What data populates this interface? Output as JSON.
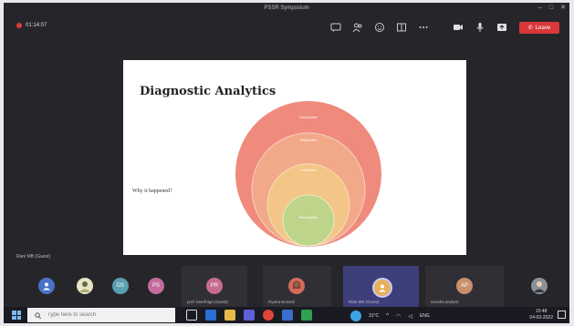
{
  "window": {
    "title": "PSSR Symposium",
    "controls": [
      "–",
      "□",
      "✕"
    ]
  },
  "meeting": {
    "recording_time": "01:14:07",
    "toolbar_icons": [
      "chat-icon",
      "people-icon",
      "reactions-icon",
      "rooms-icon",
      "more-icon"
    ],
    "media_icons": [
      "camera-icon",
      "mic-icon",
      "share-icon"
    ],
    "leave_label": "Leave",
    "colors": {
      "leave": "#d9383b",
      "record": "#e23b3b"
    }
  },
  "slide": {
    "title": "Diagnostic Analytics",
    "question": "Why it happened?",
    "circle_labels": [
      "Descriptive",
      "Diagnostic",
      "Predictive",
      "Prescriptive"
    ],
    "colors": [
      "#ef8a7d",
      "#f2a98a",
      "#f3c586",
      "#bfd48b"
    ]
  },
  "presenter_label": "Rani MB (Guest)",
  "participants": [
    {
      "initials": "",
      "name": "",
      "color": "#4b71c8",
      "icon": "user-icon"
    },
    {
      "initials": "",
      "name": "",
      "color": "#8a9a6a",
      "icon": "photo-avatar"
    },
    {
      "initials": "DS",
      "name": "",
      "color": "#5a9fb0"
    },
    {
      "initials": "PS",
      "name": "",
      "color": "#c66b9e"
    },
    {
      "initials": "PR",
      "name": "prof. keerthiga (Guest)",
      "color": "#c76b8e"
    },
    {
      "initials": "",
      "name": "Ryana Bosomi",
      "color": "#d36a5a",
      "icon": "photo-avatar"
    },
    {
      "initials": "",
      "name": "Rani MB (Guest)",
      "color": "#e8b05a",
      "icon": "user-icon"
    },
    {
      "initials": "AP",
      "name": "anusha analyst",
      "color": "#c9906b"
    },
    {
      "initials": "",
      "name": "",
      "color": "#8b8f98",
      "icon": "photo-avatar"
    }
  ],
  "taskbar": {
    "search_placeholder": "Type here to search",
    "time": "15:48",
    "date": "04-03-2022",
    "weather": "31°C",
    "lang": "ENG"
  }
}
